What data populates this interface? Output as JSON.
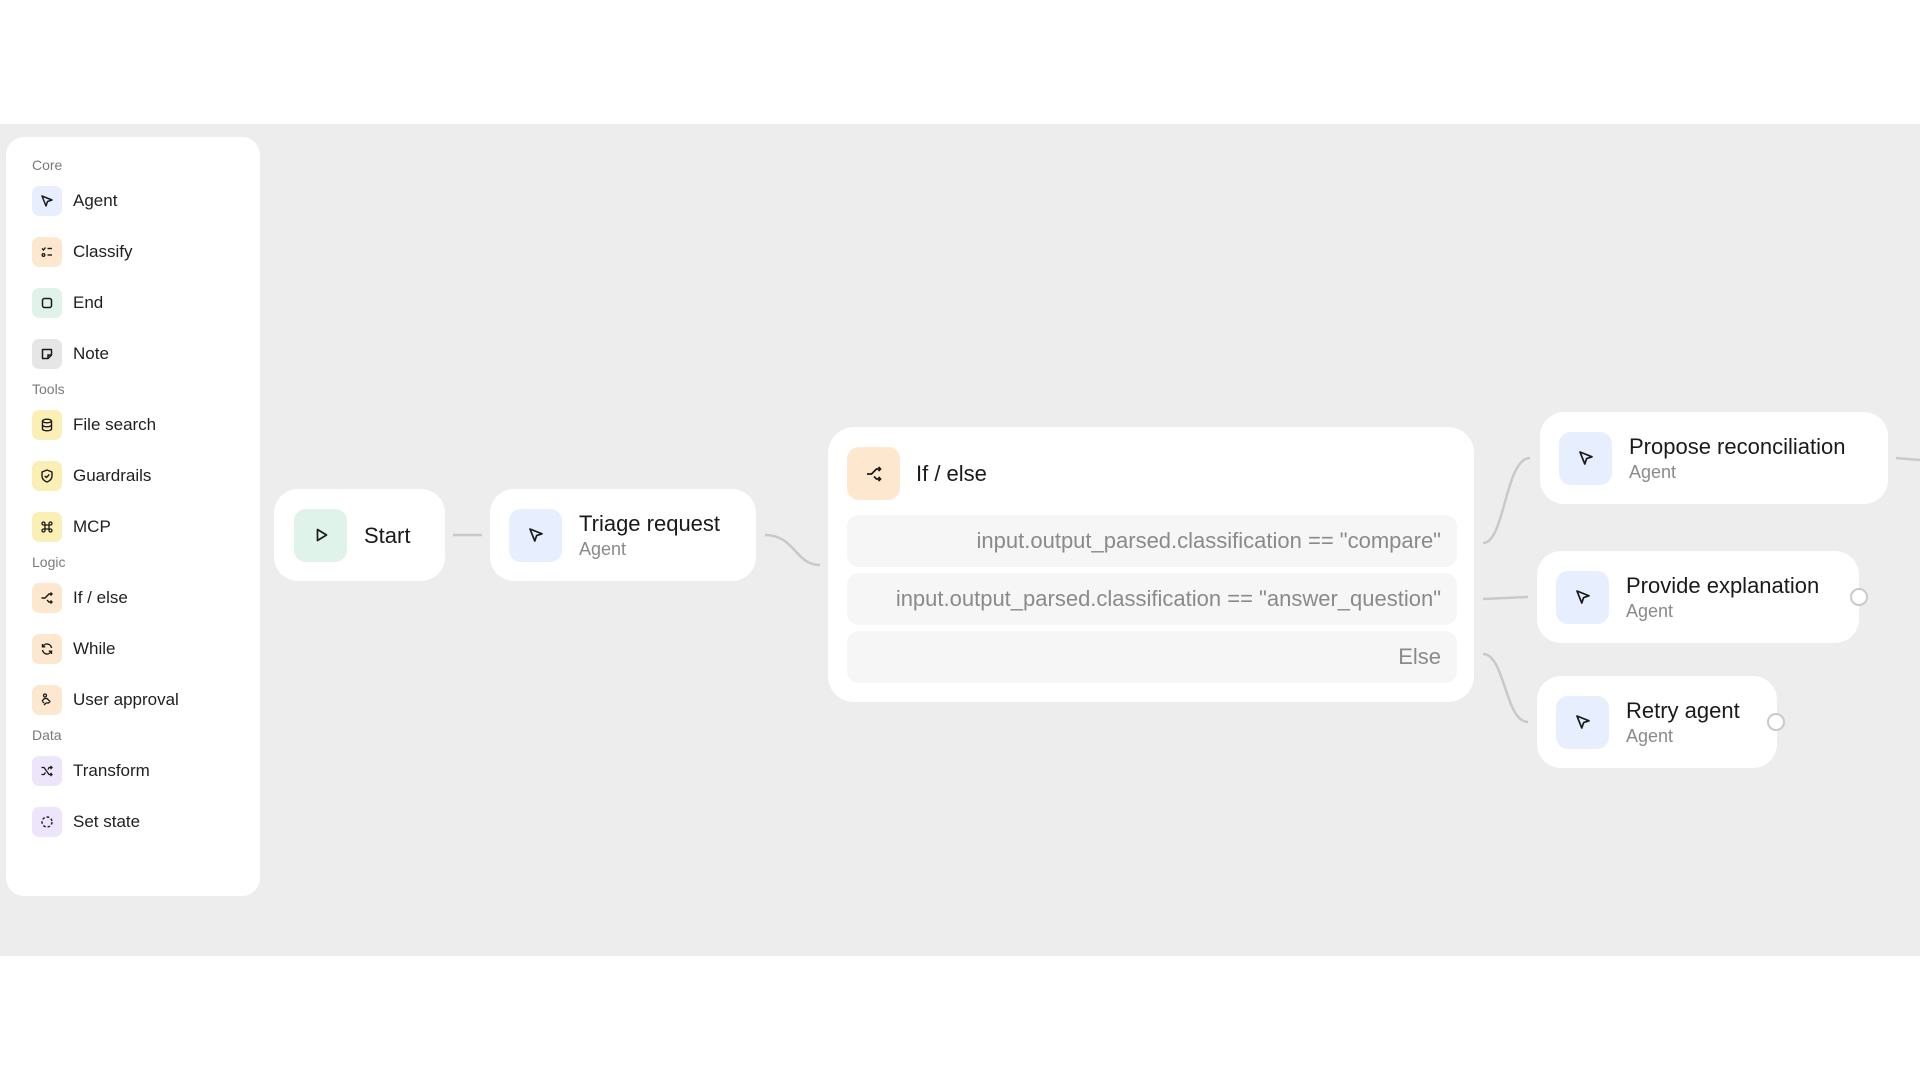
{
  "palette": {
    "sections": [
      {
        "label": "Core",
        "items": [
          {
            "label": "Agent",
            "icon": "agent-cursor-icon",
            "color": "#e7effe"
          },
          {
            "label": "Classify",
            "icon": "classify-list-icon",
            "color": "#fde8cf"
          },
          {
            "label": "End",
            "icon": "end-square-icon",
            "color": "#dff3ea"
          },
          {
            "label": "Note",
            "icon": "note-sticky-icon",
            "color": "#e6e6e6"
          }
        ]
      },
      {
        "label": "Tools",
        "items": [
          {
            "label": "File search",
            "icon": "database-icon",
            "color": "#fcefb5"
          },
          {
            "label": "Guardrails",
            "icon": "shield-check-icon",
            "color": "#fcefb5"
          },
          {
            "label": "MCP",
            "icon": "command-icon",
            "color": "#fcefb5"
          }
        ]
      },
      {
        "label": "Logic",
        "items": [
          {
            "label": "If / else",
            "icon": "branch-icon",
            "color": "#fde8cf"
          },
          {
            "label": "While",
            "icon": "loop-icon",
            "color": "#fde8cf"
          },
          {
            "label": "User approval",
            "icon": "hand-approval-icon",
            "color": "#fde8cf"
          }
        ]
      },
      {
        "label": "Data",
        "items": [
          {
            "label": "Transform",
            "icon": "shuffle-icon",
            "color": "#ece5fb"
          },
          {
            "label": "Set state",
            "icon": "dashed-circle-icon",
            "color": "#ece5fb"
          }
        ]
      }
    ]
  },
  "nodes": {
    "start": {
      "title": "Start"
    },
    "triage": {
      "title": "Triage request",
      "subtitle": "Agent"
    },
    "ifelse": {
      "title": "If / else",
      "conditions": [
        "input.output_parsed.classification == \"compare\"",
        "input.output_parsed.classification == \"answer_question\"",
        "Else"
      ]
    },
    "propose": {
      "title": "Propose reconciliation",
      "subtitle": "Agent"
    },
    "explain": {
      "title": "Provide explanation",
      "subtitle": "Agent"
    },
    "retry": {
      "title": "Retry agent",
      "subtitle": "Agent"
    }
  },
  "colors": {
    "canvas": "#ededed",
    "edge": "#c9c9c9",
    "agent": "#e7effe",
    "start": "#dff3ea",
    "logic": "#fde8cf"
  }
}
